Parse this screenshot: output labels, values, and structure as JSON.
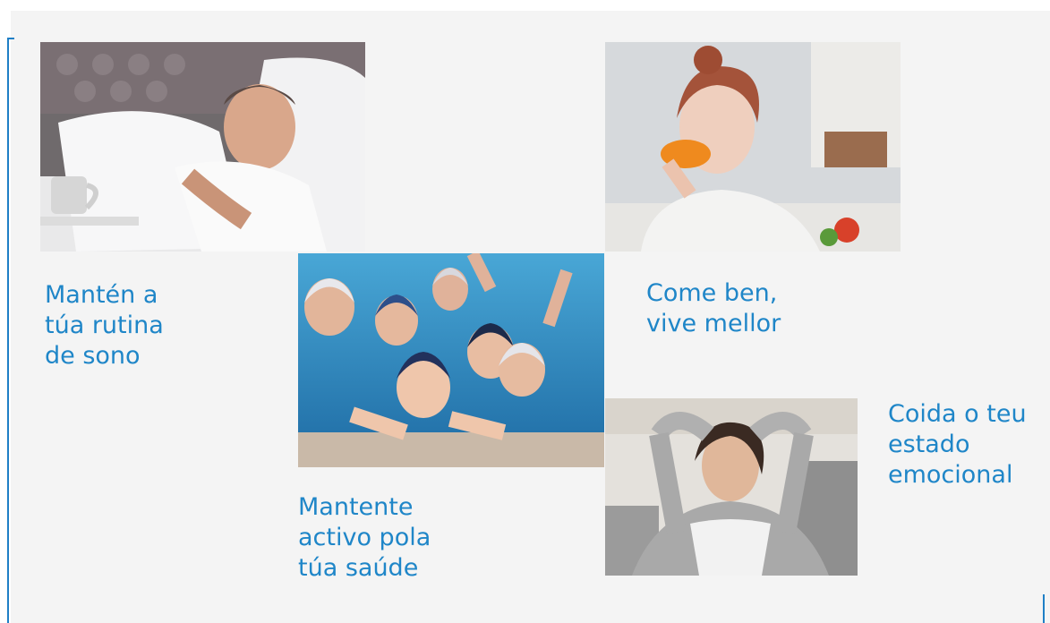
{
  "tiles": [
    {
      "key": "sleep",
      "caption": "Mantén a\ntúa rutina\nde sono",
      "image_icon": "sleeping-man-photo"
    },
    {
      "key": "active",
      "caption": "Mantente\nactivo pola\ntúa saúde",
      "image_icon": "swimmers-photo"
    },
    {
      "key": "eat",
      "caption": "Come ben,\nvive mellor",
      "image_icon": "woman-eating-orange-photo"
    },
    {
      "key": "emotion",
      "caption": "Coida o teu\nestado\nemocional",
      "image_icon": "relaxed-woman-photo"
    }
  ],
  "colors": {
    "accent": "#1f86c8",
    "background": "#f4f4f4"
  }
}
